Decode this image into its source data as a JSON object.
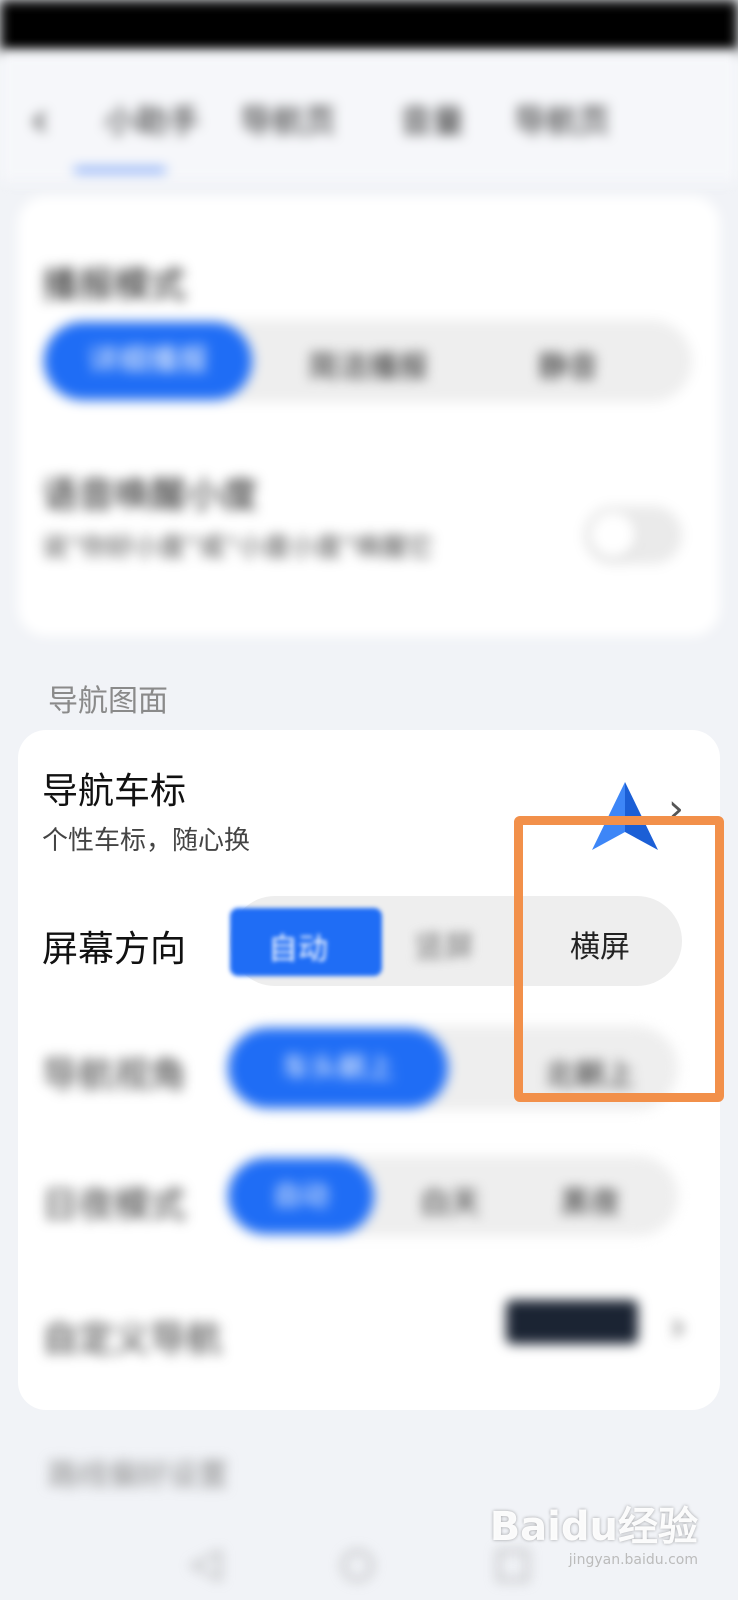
{
  "status_bar": {
    "time": "",
    "icons": ""
  },
  "header": {
    "back_icon": "back-arrow-icon",
    "tabs": [
      {
        "label": "小助手"
      },
      {
        "label": "导航页"
      },
      {
        "label": "音量"
      },
      {
        "label": "导航页"
      }
    ]
  },
  "voice_card": {
    "broadcast_mode": {
      "label": "播报模式",
      "options": [
        "详细播报",
        "简洁播报",
        "静音"
      ],
      "selected": "详细播报"
    },
    "voice_wake": {
      "label": "语音唤醒小度",
      "description": "说“你好小度”或“小度小度”唤醒它",
      "enabled": false
    }
  },
  "section": {
    "title": "导航图面"
  },
  "nav_card": {
    "car_icon": {
      "label": "导航车标",
      "description": "个性车标，随心换",
      "icon": "navigation-arrow-icon"
    },
    "screen_orientation": {
      "label": "屏幕方向",
      "options": [
        "自动",
        "竖屏",
        "横屏"
      ],
      "selected": "自动"
    },
    "north_mode": {
      "label": "导航视角",
      "options": [
        "车头朝上",
        "北朝上"
      ],
      "selected": "车头朝上"
    },
    "day_night": {
      "label": "日夜模式",
      "options": [
        "自动",
        "白天",
        "黑夜"
      ],
      "selected": "自动"
    },
    "custom_skin": {
      "label": "自定义导航"
    }
  },
  "next_section": {
    "title": "路线偏好设置"
  },
  "watermark": {
    "text": "Baidu经验",
    "url": "jingyan.baidu.com"
  },
  "colors": {
    "accent": "#1f6df5",
    "highlight": "#f2904a"
  }
}
